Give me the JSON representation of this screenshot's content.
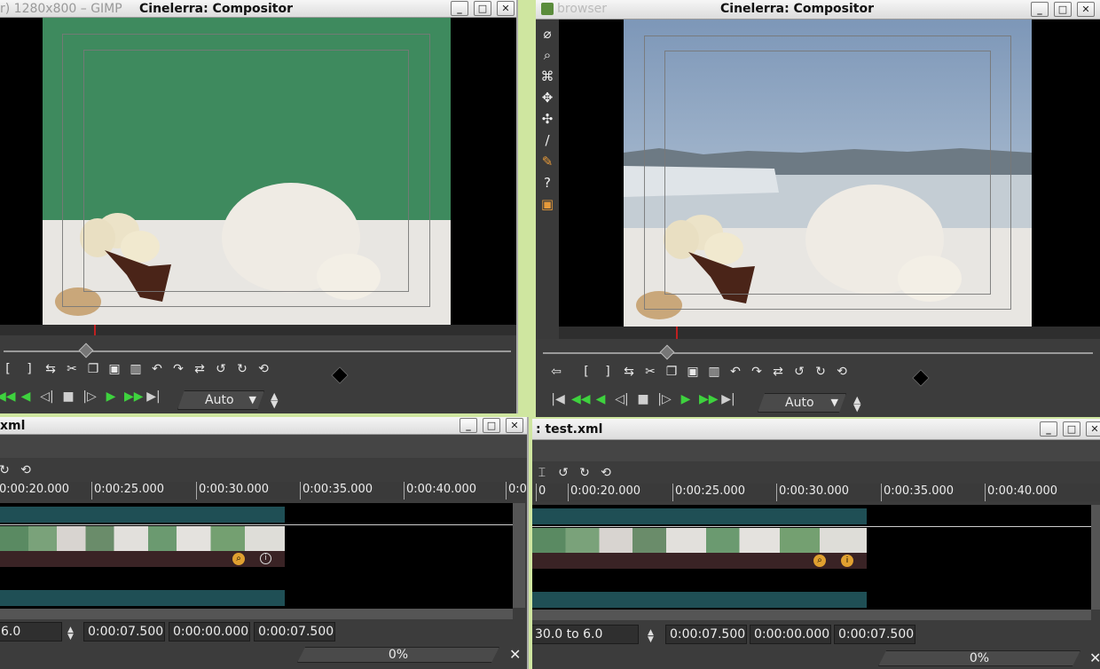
{
  "left_compositor": {
    "gimp_title_fragment": "r) 1280x800 – GIMP",
    "title": "Cinelerra: Compositor",
    "zoom_value": "Auto"
  },
  "right_compositor": {
    "browser_title_fragment": "browser",
    "title": "Cinelerra: Compositor",
    "zoom_value": "Auto"
  },
  "left_program": {
    "title": "xml",
    "ruler_ticks": [
      "0:00:20.000",
      "0:00:25.000",
      "0:00:30.000",
      "0:00:35.000",
      "0:00:40.000",
      "0:0"
    ],
    "status": {
      "selection": "6.0",
      "field1": "0:00:07.500",
      "field2": "0:00:00.000",
      "field3": "0:00:07.500"
    },
    "progress_text": "0%"
  },
  "right_program": {
    "title": ": test.xml",
    "ruler_ticks": [
      "0:00:20.000",
      "0:00:25.000",
      "0:00:30.000",
      "0:00:35.000",
      "0:00:40.000"
    ],
    "ruler_lead": "0",
    "status": {
      "selection": "30.0 to 6.0",
      "field1": "0:00:07.500",
      "field2": "0:00:00.000",
      "field3": "0:00:07.500"
    },
    "progress_text": "0%"
  },
  "window_buttons": {
    "minimize": "_",
    "maximize": "□",
    "close": "✕"
  },
  "icons": {
    "transport": [
      "skip-start-icon",
      "fast-rewind-icon",
      "rewind-icon",
      "frame-back-icon",
      "stop-icon",
      "frame-forward-icon",
      "play-icon",
      "fast-forward-icon",
      "skip-end-icon"
    ],
    "tools": [
      "protect-icon",
      "zoom-icon",
      "mask-icon",
      "camera-icon",
      "projector-icon",
      "crop-icon",
      "eyedropper-icon",
      "help-icon",
      "safe-region-icon"
    ]
  }
}
